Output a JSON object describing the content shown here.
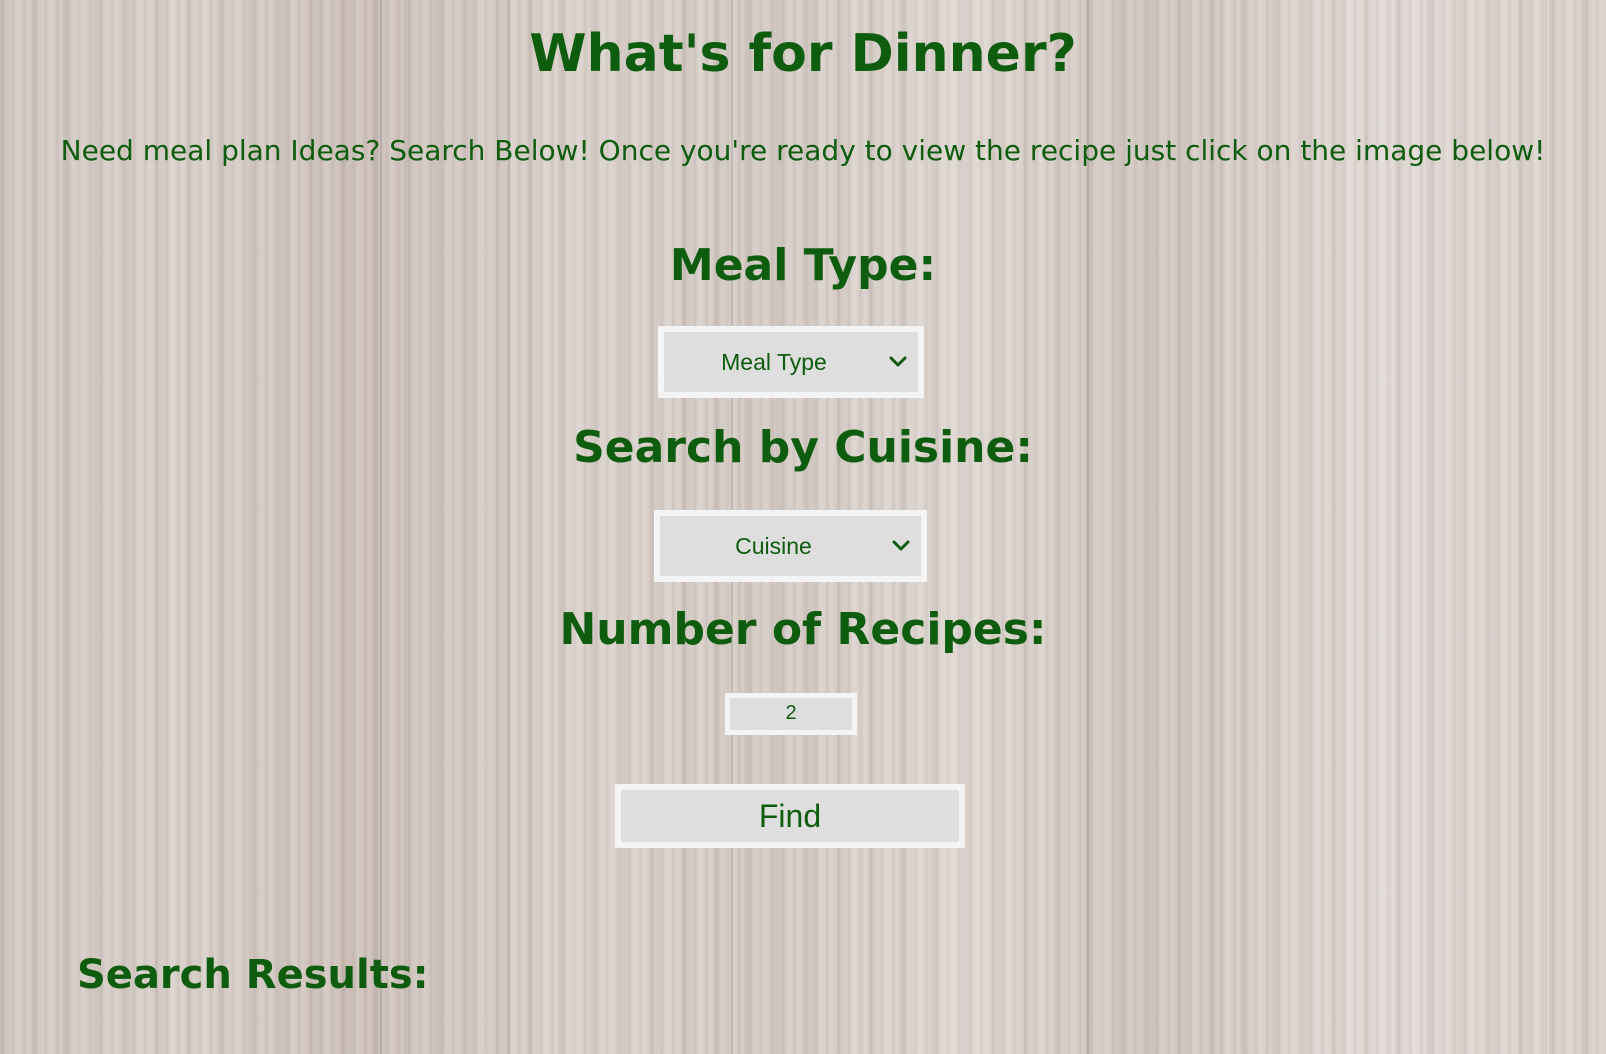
{
  "page": {
    "title": "What's for Dinner?",
    "intro": "Need meal plan Ideas? Search Below! Once you're ready to view the recipe just click on the image below!"
  },
  "meal_type": {
    "heading": "Meal Type:",
    "selected": "Meal Type"
  },
  "cuisine": {
    "heading": "Search by Cuisine:",
    "selected": "Cuisine"
  },
  "recipes": {
    "heading": "Number of Recipes:",
    "value": "2"
  },
  "find_button": {
    "label": "Find"
  },
  "results": {
    "heading": "Search Results:"
  },
  "colors": {
    "text": "#0e5c0e",
    "control_bg": "#dedede",
    "control_border": "#f4f4f4"
  }
}
